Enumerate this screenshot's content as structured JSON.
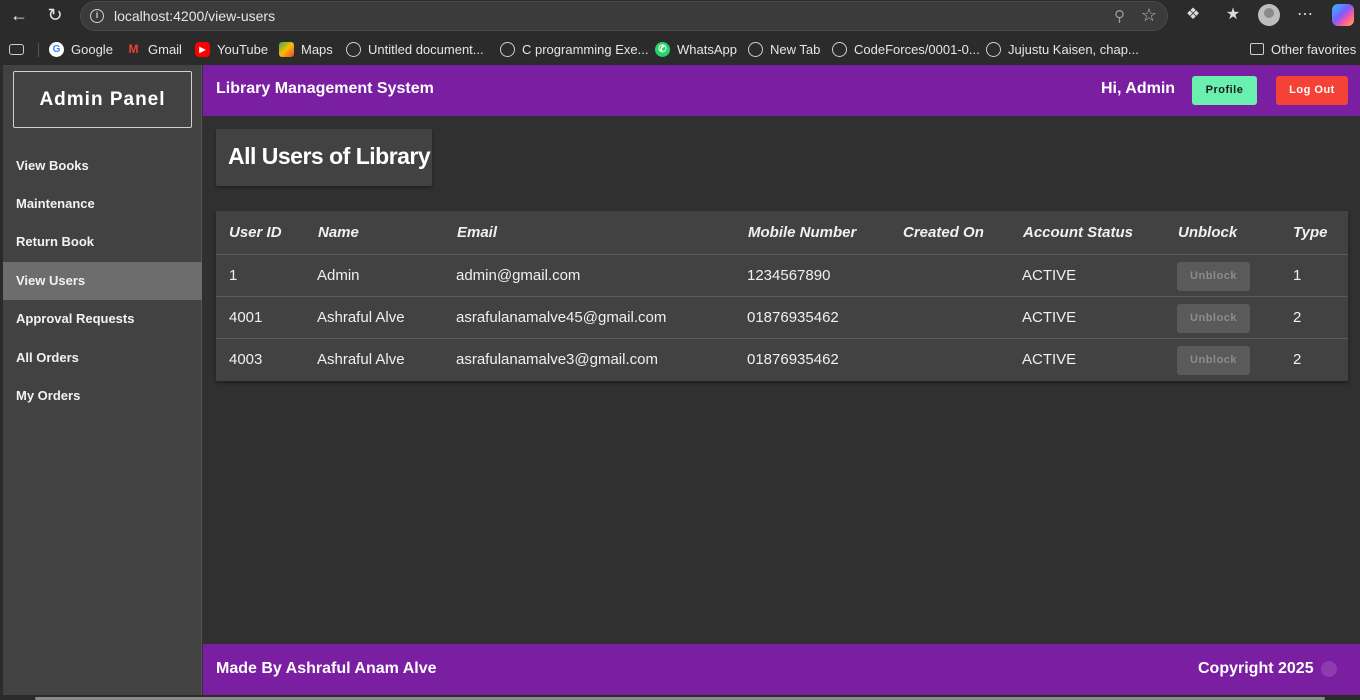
{
  "browser": {
    "url": "localhost:4200/view-users",
    "bookmarks": [
      {
        "label": "Google",
        "icon": "google-icon"
      },
      {
        "label": "Gmail",
        "icon": "gmail-icon"
      },
      {
        "label": "YouTube",
        "icon": "youtube-icon"
      },
      {
        "label": "Maps",
        "icon": "maps-icon"
      },
      {
        "label": "Untitled document...",
        "icon": "globe-icon"
      },
      {
        "label": "C programming Exe...",
        "icon": "globe-icon"
      },
      {
        "label": "WhatsApp",
        "icon": "whatsapp-icon"
      },
      {
        "label": "New Tab",
        "icon": "globe-icon"
      },
      {
        "label": "CodeForces/0001-0...",
        "icon": "globe-icon"
      },
      {
        "label": "Jujustu Kaisen, chap...",
        "icon": "globe-icon"
      }
    ],
    "other_favorites": "Other favorites"
  },
  "sidebar": {
    "brand": "Admin Panel",
    "items": [
      {
        "label": "View Books",
        "active": false
      },
      {
        "label": "Maintenance",
        "active": false
      },
      {
        "label": "Return Book",
        "active": false
      },
      {
        "label": "View Users",
        "active": true
      },
      {
        "label": "Approval Requests",
        "active": false
      },
      {
        "label": "All Orders",
        "active": false
      },
      {
        "label": "My Orders",
        "active": false
      }
    ]
  },
  "header": {
    "title": "Library Management System",
    "greeting": "Hi, Admin",
    "profile_label": "Profile",
    "logout_label": "Log Out"
  },
  "page": {
    "title": "All Users of Library"
  },
  "table": {
    "columns": [
      "User ID",
      "Name",
      "Email",
      "Mobile Number",
      "Created On",
      "Account Status",
      "Unblock",
      "Type"
    ],
    "rows": [
      {
        "user_id": "1",
        "name": "Admin",
        "email": "admin@gmail.com",
        "mobile": "1234567890",
        "created_on": "",
        "status": "ACTIVE",
        "unblock": "Unblock",
        "type": "1"
      },
      {
        "user_id": "4001",
        "name": "Ashraful Alve",
        "email": "asrafulanamalve45@gmail.com",
        "mobile": "01876935462",
        "created_on": "",
        "status": "ACTIVE",
        "unblock": "Unblock",
        "type": "2"
      },
      {
        "user_id": "4003",
        "name": "Ashraful Alve",
        "email": "asrafulanamalve3@gmail.com",
        "mobile": "01876935462",
        "created_on": "",
        "status": "ACTIVE",
        "unblock": "Unblock",
        "type": "2"
      }
    ]
  },
  "footer": {
    "left": "Made By Ashraful Anam Alve",
    "right": "Copyright 2025"
  },
  "colors": {
    "accent": "#7b1fa2",
    "profile_button": "#69f0ae",
    "logout_button": "#f44336",
    "sidebar_bg": "#424242",
    "sidebar_active": "#6d6d6d"
  }
}
